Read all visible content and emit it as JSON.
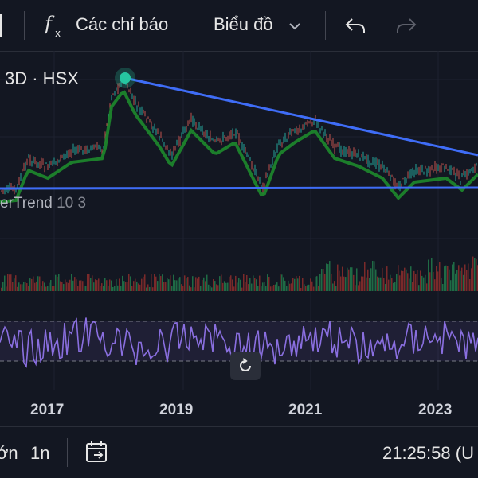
{
  "toolbar": {
    "indicators_label": "Các chỉ báo",
    "chart_type_label": "Biểu đồ"
  },
  "symbol": {
    "label": "3D · HSX"
  },
  "indicator": {
    "name": "erTrend",
    "params": "10 3"
  },
  "colors": {
    "background": "#131722",
    "trendline": "#3f6df7",
    "supertrend_up": "#1e8a2c",
    "supertrend_down": "#8a1c22",
    "rsi": "#8a6fe0",
    "volume_up": "#1f6b45",
    "volume_down": "#7a2a2a",
    "marker": "#26c6a0"
  },
  "chart_data": {
    "type": "line",
    "x_ticks": [
      "2017",
      "2019",
      "2021",
      "2023"
    ],
    "grid": true
  },
  "bottom": {
    "range_partial": "ớn",
    "range_1y": "1n",
    "time": "21:25:58 (U"
  },
  "icons": {
    "fx": "function-icon",
    "chevron": "chevron-down-icon",
    "undo": "undo-icon",
    "redo": "redo-icon",
    "reset": "reset-icon",
    "date_range": "date-range-icon"
  }
}
